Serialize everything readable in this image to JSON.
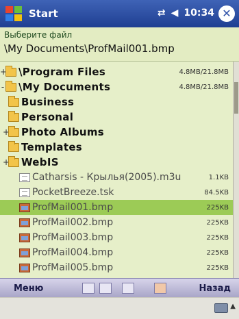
{
  "titlebar": {
    "title": "Start",
    "time": "10:34",
    "connectivity_icon": "connection-arrows-icon",
    "volume_icon": "speaker-icon",
    "close_label": "✕"
  },
  "header": {
    "prompt": "Выберите файл",
    "path": "\\My Documents\\ProfMail001.bmp"
  },
  "list": {
    "rows": [
      {
        "type": "folder",
        "expander": "+",
        "label": "\\Program Files",
        "size": "4.8MB/21.8MB"
      },
      {
        "type": "folder",
        "expander": "-",
        "label": "\\My Documents",
        "size": "4.8MB/21.8MB"
      },
      {
        "type": "folder",
        "expander": "",
        "label": "Business",
        "size": ""
      },
      {
        "type": "folder",
        "expander": "",
        "label": "Personal",
        "size": ""
      },
      {
        "type": "folder",
        "expander": "+",
        "label": "Photo Albums",
        "size": ""
      },
      {
        "type": "folder",
        "expander": "",
        "label": "Templates",
        "size": ""
      },
      {
        "type": "folder",
        "expander": "+",
        "label": "WebIS",
        "size": ""
      },
      {
        "type": "file",
        "expander": "",
        "label": "Catharsis - Крылья(2005).m3u",
        "size": "1.1KB"
      },
      {
        "type": "file",
        "expander": "",
        "label": "PocketBreeze.tsk",
        "size": "84.5KB"
      },
      {
        "type": "image",
        "expander": "",
        "label": "ProfMail001.bmp",
        "size": "225KB",
        "selected": true
      },
      {
        "type": "image",
        "expander": "",
        "label": "ProfMail002.bmp",
        "size": "225KB"
      },
      {
        "type": "image",
        "expander": "",
        "label": "ProfMail003.bmp",
        "size": "225KB"
      },
      {
        "type": "image",
        "expander": "",
        "label": "ProfMail004.bmp",
        "size": "225KB"
      },
      {
        "type": "image",
        "expander": "",
        "label": "ProfMail005.bmp",
        "size": "225KB"
      }
    ]
  },
  "menubar": {
    "left": "Меню",
    "right": "Назад",
    "tools": [
      "cut-icon",
      "copy-icon",
      "paste-icon",
      "delete-icon"
    ]
  },
  "inputbar": {
    "keyboard_icon": "keyboard-icon",
    "arrow": "▲"
  }
}
